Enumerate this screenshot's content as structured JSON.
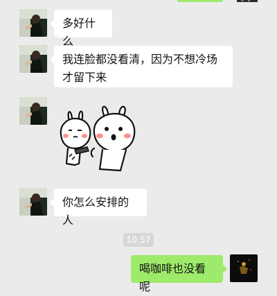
{
  "colors": {
    "background": "#ebebeb",
    "received_bubble": "#ffffff",
    "sent_bubble": "#9eea6a",
    "timestamp_bg": "#d7d7d7"
  },
  "messages": [
    {
      "from": "contact",
      "text": "多好什么"
    },
    {
      "from": "contact",
      "text": "我连脸都没看清，因为不想冷场才留下来"
    },
    {
      "from": "contact",
      "sticker": "two-white-rabbits-sticker"
    },
    {
      "from": "contact",
      "text": "你怎么安排的人"
    },
    {
      "from": "me",
      "text": "喝咖啡也没看呢"
    }
  ],
  "timestamp": "10:57"
}
